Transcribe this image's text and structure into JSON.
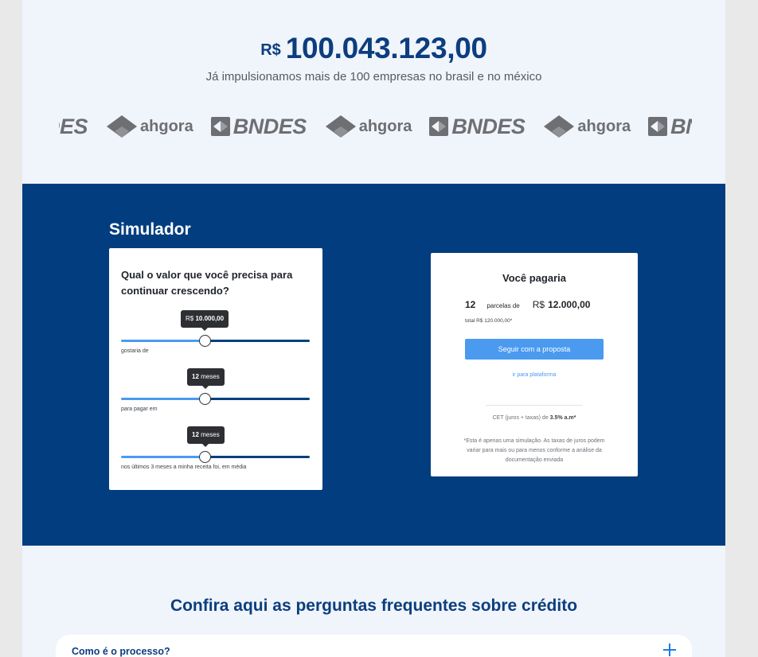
{
  "hero": {
    "currency": "R$",
    "amount": "100.043.123,00",
    "tagline": "Já impulsionamos mais de 100 empresas no brasil e no méxico"
  },
  "partners": {
    "logos": [
      {
        "name": "BNDES",
        "icon": "bndes-logo-icon"
      },
      {
        "name": "ahgora",
        "icon": "ahgora-logo-icon"
      },
      {
        "name": "BNDES",
        "icon": "bndes-logo-icon"
      },
      {
        "name": "ahgora",
        "icon": "ahgora-logo-icon"
      },
      {
        "name": "BNDES",
        "icon": "bndes-logo-icon"
      },
      {
        "name": "ahgora",
        "icon": "ahgora-logo-icon"
      },
      {
        "name": "BNDES",
        "icon": "bndes-logo-icon"
      }
    ]
  },
  "simulator": {
    "title": "Simulador",
    "question": "Qual o valor que você precisa para continuar crescendo?",
    "sliders": [
      {
        "tooltip_prefix": "R$",
        "tooltip_value": "10.000,00",
        "tooltip_suffix": "",
        "label": "gostaria de",
        "level": 0.45
      },
      {
        "tooltip_prefix": "",
        "tooltip_value": "12",
        "tooltip_suffix": "meses",
        "label": "para pagar em",
        "level": 0.45
      },
      {
        "tooltip_prefix": "",
        "tooltip_value": "12",
        "tooltip_suffix": "meses",
        "label": "nos últimos 3 meses a minha receita foi, em média",
        "level": 0.45
      }
    ],
    "result": {
      "heading": "Você pagaria",
      "installments": "12",
      "installments_word": "parcelas de",
      "currency": "R$",
      "installment_value": "12.000,00",
      "total": "total R$ 120.000,00*",
      "cta": "Seguir com a proposta",
      "platform_link": "ir para plataforma",
      "cet_prefix": "CET (juros + taxas) de",
      "cet_value": "3.5% a.m*",
      "disclaimer": "*Esta é apenas uma simulação. As taxas de juros podem variar para mais ou para menos conforme a análise da documentação enviada"
    }
  },
  "faq": {
    "title": "Confira aqui as perguntas frequentes sobre crédito",
    "items": [
      {
        "question": "Como é o processo?",
        "icon": "plus-icon"
      }
    ]
  },
  "colors": {
    "brand_dark": "#023d7f",
    "accent": "#4a9af0",
    "heading": "#0c3e7e",
    "page_bg": "#f0f4fb"
  }
}
